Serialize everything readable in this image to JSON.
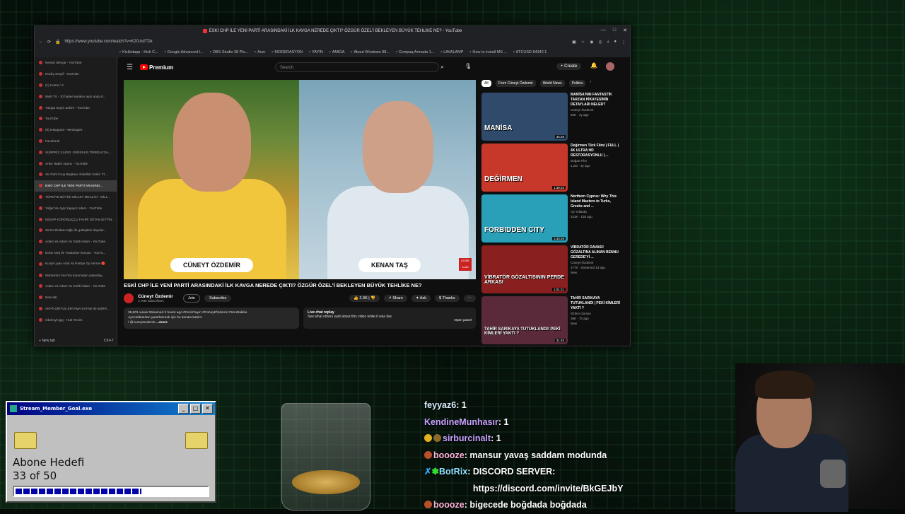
{
  "browser": {
    "window_title": "ESKİ CHP İLE YENİ PARTİ ARASINDAKİ İLK KAVGA NEREDE ÇIKTI? ÖZGÜR ÖZEL'İ BEKLEYEN BÜYÜK TEHLİKE NE? - YouTube",
    "url": "https://www.youtube.com/watch?v=K20-hdTDk",
    "bookmarks": [
      "Kicklotapp - Kick C...",
      "Google Advanced I...",
      "OBS Studio 28 Plu...",
      "Acer",
      "MODERASYON",
      "YAYIN",
      "AMIGA",
      "About Windows 98...",
      "Compaq Armada 1...",
      "LAVALAMP",
      "How to install MS ...",
      "8TCUSD 84342.1"
    ],
    "tabs": [
      "Nevşin Mengü - YouTube",
      "Rocky Serpil - YouTube",
      "(1) Home / X",
      "Multi TV - 10 haber kanalını aynı anda iz...",
      "Yazgat seçim anketi - YouTube",
      "YouTube",
      "(9) Instagram • Messages",
      "Facebook",
      "SÜRPRİZ ÇAĞRI: GERESUN TİRBOLU'DA...",
      "Ankn Haber Ajansı - YouTube",
      "AK Parti Grup Başkanı Abdullah Güler: Tİ...",
      "ESKİ CHP İLE YENİ PARTİ ARASIND...",
      "TÜRKİYE BÜYÜK MİLLET MECLİSİ - MİLL...",
      "Yoğurt ile Ayşi Yapıyor Adam - YouTube",
      "KEBAP KORONUÇÇU FAHRİ ÜSTAN (ETTİN...",
      "Zerrin Zindancıoğlu ile gülüşüleri dayalar...",
      "Adam Ya Adam Ya Geldi Adam - YouTube",
      "Dönü Ateş ile Tutulanlar konusu - YouTu...",
      "Kurşe Uyan Artık Ak Partiye Oy Verme 🔴",
      "Muharrem İnce'nin kurumaları yalanday...",
      "Adam Ya Adam Ya Geldi Adam - YouTube",
      "New tab",
      "AKP'li DİRYOL ERYAMA KAYNK ile BÜRR...",
      "nibdv1yh.jpg - Hub Resim"
    ],
    "new_tab_label": "New tab",
    "new_tab_shortcut": "Ctrl+T"
  },
  "youtube": {
    "logo_text": "Premium",
    "search_placeholder": "Search",
    "create_label": "+ Create",
    "video": {
      "left_name": "CÜNEYT ÖZDEMİR",
      "right_name": "KENAN TAŞ",
      "badge": "ATORE ALAN"
    },
    "title": "ESKİ CHP İLE YENİ PARTİ ARASINDAKİ İLK KAVGA NEREDE ÇIKTI? ÖZGÜR ÖZEL'İ BEKLEYEN BÜYÜK TEHLİKE NE?",
    "channel": "Cüneyt Özdemir",
    "subscribers": "1.76M subscribers",
    "join_label": "Join",
    "subscribe_label": "Subscribe",
    "likes": "2.3K",
    "share_label": "Share",
    "ask_label": "Ask",
    "thanks_label": "Thanks",
    "description_stats": "38,601 views  Streamed 3 hours ago  #CenkYayın #CüneytÖzdemir #SonDakika",
    "description_text": "Ayrıcalıklardan yararlanmak için bu kanala katılın:",
    "description_link": "/ @cuneytozdemir",
    "description_more": "...more",
    "live_chat_title": "Live chat replay",
    "live_chat_text": "See what others said about this video while it was live.",
    "open_panel": "Open panel",
    "chips": [
      "All",
      "From Cüneyt Özdemir",
      "World News",
      "Politics"
    ],
    "recommendations": [
      {
        "title": "MANİSA'NIN FANTASTİK TARZAN HİKAYESİNİN DETAYLARI NELER?",
        "channel": "Cüneyt Özdemir",
        "meta": "84K · 4y ago",
        "duration": "35:28",
        "thumb_text": "MANİSA",
        "thumb_color": "#2f4a6a"
      },
      {
        "title": "Değirmen Türk Filmi | FULL | 4K ULTRA HD RESTORASYONLU | ...",
        "channel": "Doğan Film",
        "meta": "1.1M · 3y ago",
        "duration": "1:38:34",
        "thumb_text": "DEĞİRMEN",
        "thumb_color": "#c8382a"
      },
      {
        "title": "Northern Cyprus: Why This Island Masters to Turks, Greeks and ...",
        "channel": "Ap Yollarda",
        "meta": "223K · 13d ago",
        "duration": "1:33:26",
        "thumb_text": "FORBIDDEN CITY",
        "thumb_color": "#2aa0b8"
      },
      {
        "title": "VİBRATÖR DAVASI! GÖZALTINA ALINAN BENNU GEREDE'Yİ ...",
        "channel": "Cüneyt Özdemir",
        "meta": "177K · Streamed 1d ago",
        "duration": "1:01:21",
        "thumb_text": "VİBRATÖR GÖZALTISININ PERDE ARKASI",
        "thumb_color": "#8a1f1f"
      },
      {
        "title": "TAHİR SARIKAYA TUTUKLANDI | PEKİ KİMLERİ YAKTI ?",
        "channel": "Özlem Gürses",
        "meta": "39K · 7h ago",
        "duration": "31:45",
        "thumb_text": "TAHİR SARIKAYA TUTUKLANDI! PEKİ KİMLERİ YAKTI ?",
        "thumb_color": "#5a2a3a"
      }
    ],
    "new_badge": "New"
  },
  "goal_widget": {
    "window_title": "Stream_Member_Goal.exe",
    "label": "Abone Hedefi",
    "count_text": "33 of 50",
    "current": 33,
    "target": 50
  },
  "chat": [
    {
      "user": "feyyaz6",
      "text": "1"
    },
    {
      "user": "KendineMunhasır",
      "text": "1"
    },
    {
      "user": "sirburcinalt",
      "text": "1"
    },
    {
      "user": "boooze",
      "text": "mansur yavaş saddam modunda"
    },
    {
      "user": "BotRix",
      "text": "DISCORD SERVER: https://discord.com/invite/BkGEJbY"
    },
    {
      "user": "boooze",
      "text": "bigecede boğdada boğdada"
    }
  ]
}
